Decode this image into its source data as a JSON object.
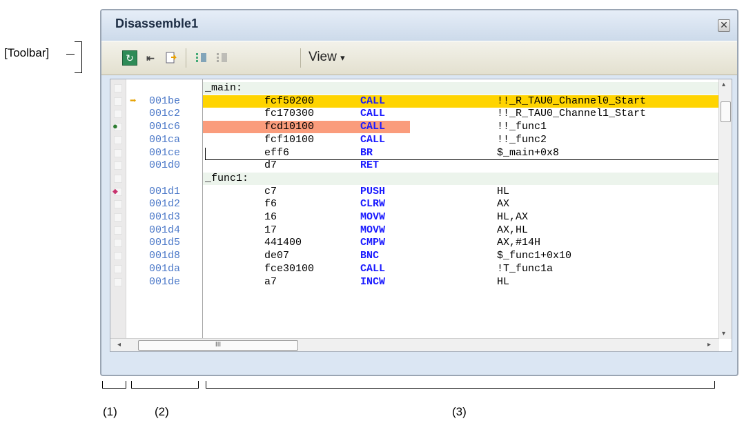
{
  "annotations": {
    "toolbar": "[Toolbar]",
    "area1": "(1)",
    "area2": "(2)",
    "area3": "(3)"
  },
  "window": {
    "title": "Disassemble1",
    "close_icon": "close-icon"
  },
  "toolbar": {
    "buttons": [
      "refresh-icon",
      "go-to-pc-icon",
      "go-to-symbol-icon",
      "step-in-icon",
      "step-out-icon"
    ],
    "view_label": "View",
    "view_arrow": "▾"
  },
  "colors": {
    "pc_highlight": "#ffd400",
    "breakpoint_highlight": "#fa9c7c",
    "label_bg": "#ecf4ec",
    "address": "#4b78c8",
    "mnemonic": "#1a1aff"
  },
  "scroll": {
    "h_thumb_label": "III",
    "left_arrow": "◂",
    "right_arrow": "▸",
    "up_arrow": "▴",
    "down_arrow": "▾"
  },
  "rows": [
    {
      "type": "label",
      "label": "_main:"
    },
    {
      "type": "instr",
      "addr": "001be",
      "code": "fcf50200",
      "mnem": "CALL",
      "oper": "!!_R_TAU0_Channel0_Start",
      "highlight": "pc",
      "marker": "pc-arrow"
    },
    {
      "type": "instr",
      "addr": "001c2",
      "code": "fc170300",
      "mnem": "CALL",
      "oper": "!!_R_TAU0_Channel1_Start"
    },
    {
      "type": "instr",
      "addr": "001c6",
      "code": "fcd10100",
      "mnem": "CALL",
      "oper": "!!_func1",
      "highlight": "break",
      "marker": "breakpoint"
    },
    {
      "type": "instr",
      "addr": "001ca",
      "code": "fcf10100",
      "mnem": "CALL",
      "oper": "!!_func2"
    },
    {
      "type": "instr",
      "addr": "001ce",
      "code": "eff6",
      "mnem": "BR",
      "oper": "$_main+0x8"
    },
    {
      "type": "instr",
      "addr": "001d0",
      "code": "d7",
      "mnem": "RET",
      "oper": ""
    },
    {
      "type": "label",
      "label": "_func1:"
    },
    {
      "type": "instr",
      "addr": "001d1",
      "code": "c7",
      "mnem": "PUSH",
      "oper": "HL",
      "marker": "event"
    },
    {
      "type": "instr",
      "addr": "001d2",
      "code": "f6",
      "mnem": "CLRW",
      "oper": "AX"
    },
    {
      "type": "instr",
      "addr": "001d3",
      "code": "16",
      "mnem": "MOVW",
      "oper": "HL,AX"
    },
    {
      "type": "instr",
      "addr": "001d4",
      "code": "17",
      "mnem": "MOVW",
      "oper": "AX,HL"
    },
    {
      "type": "instr",
      "addr": "001d5",
      "code": "441400",
      "mnem": "CMPW",
      "oper": "AX,#14H"
    },
    {
      "type": "instr",
      "addr": "001d8",
      "code": "de07",
      "mnem": "BNC",
      "oper": "$_func1+0x10"
    },
    {
      "type": "instr",
      "addr": "001da",
      "code": "fce30100",
      "mnem": "CALL",
      "oper": "!T_func1a"
    },
    {
      "type": "instr",
      "addr": "001de",
      "code": "a7",
      "mnem": "INCW",
      "oper": "HL"
    }
  ]
}
